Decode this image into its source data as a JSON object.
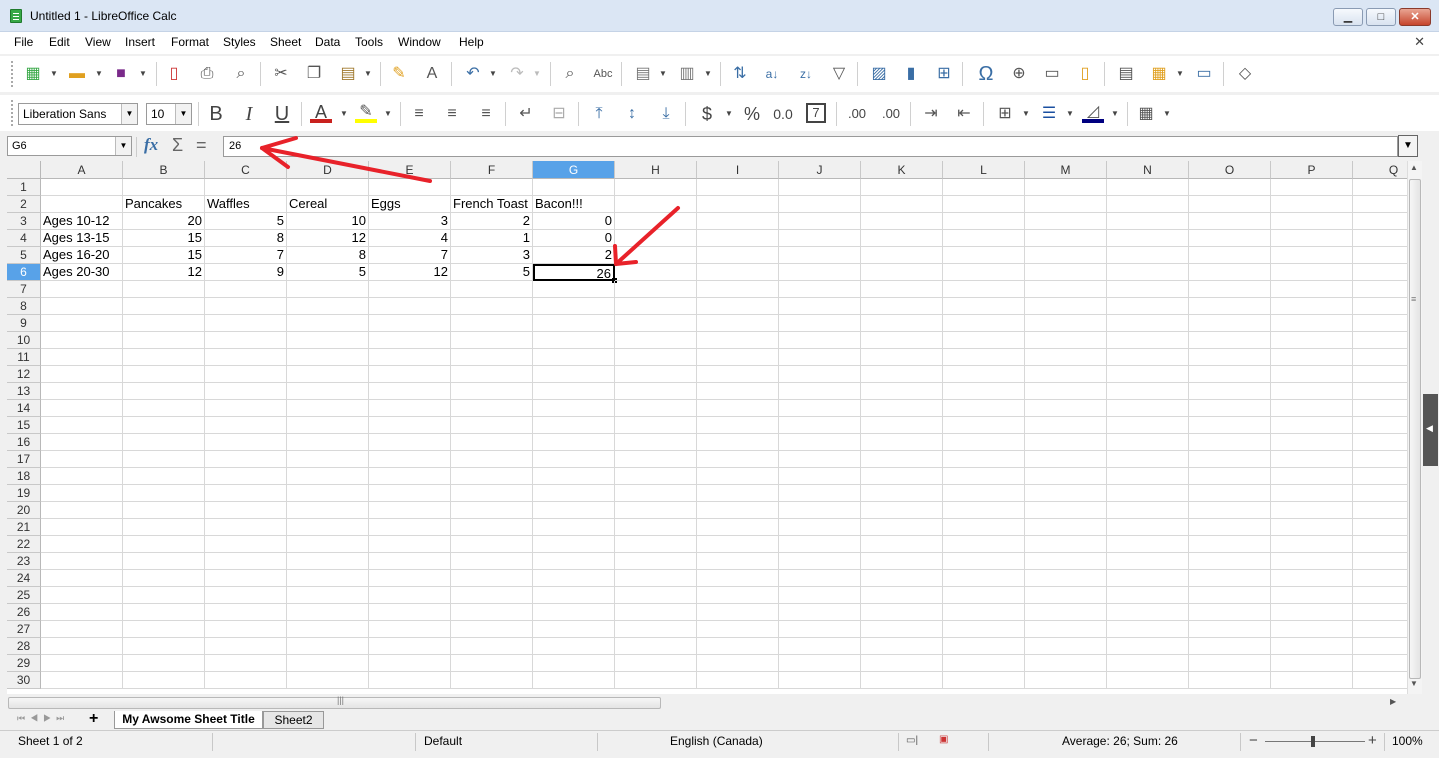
{
  "window": {
    "title": "Untitled 1 - LibreOffice Calc",
    "minimize": "▁",
    "maximize": "□",
    "close": "✕"
  },
  "menu": [
    "File",
    "Edit",
    "View",
    "Insert",
    "Format",
    "Styles",
    "Sheet",
    "Data",
    "Tools",
    "Window",
    "Help"
  ],
  "doc_close": "✕",
  "toolbar_format": {
    "font_name": "Liberation Sans",
    "font_size": "10",
    "bold": "B",
    "italic": "I",
    "underline": "U",
    "font_color": "A",
    "currency": "$",
    "percent": "%",
    "number": "0.0",
    "date": "7",
    "add_decimal": ".00",
    "del_decimal": ".00"
  },
  "formula_bar": {
    "name_box": "G6",
    "fx": "fx",
    "sum": "Σ",
    "equals": "=",
    "input": "26"
  },
  "columns": [
    "A",
    "B",
    "C",
    "D",
    "E",
    "F",
    "G",
    "H",
    "I",
    "J",
    "K",
    "L",
    "M",
    "N",
    "O",
    "P",
    "Q"
  ],
  "rows": [
    "1",
    "2",
    "3",
    "4",
    "5",
    "6",
    "7",
    "8",
    "9",
    "10",
    "11",
    "12",
    "13",
    "14",
    "15",
    "16",
    "17",
    "18",
    "19",
    "20",
    "21",
    "22",
    "23",
    "24",
    "25",
    "26",
    "27",
    "28",
    "29",
    "30"
  ],
  "selected": {
    "column": "G",
    "row": "6"
  },
  "cells": {
    "r2": [
      "",
      "Pancakes",
      "Waffles",
      "Cereal",
      "Eggs",
      "French Toast",
      "Bacon!!!"
    ],
    "r3": [
      "Ages 10-12",
      "20",
      "5",
      "10",
      "3",
      "2",
      "0"
    ],
    "r4": [
      "Ages 13-15",
      "15",
      "8",
      "12",
      "4",
      "1",
      "0"
    ],
    "r5": [
      "Ages 16-20",
      "15",
      "7",
      "8",
      "7",
      "3",
      "2"
    ],
    "r6": [
      "Ages 20-30",
      "12",
      "9",
      "5",
      "12",
      "5",
      "26"
    ]
  },
  "sheet_tabs": [
    "My Awsome Sheet Title",
    "Sheet2"
  ],
  "status": {
    "sheet": "Sheet 1 of 2",
    "page_style": "Default",
    "language": "English (Canada)",
    "summary": "Average: 26; Sum: 26",
    "zoom": "100%"
  },
  "colors": {
    "selection": "#58a2e8",
    "annotation": "#e8222a",
    "font_color_bar": "#c9211e",
    "highlight_bar": "#ffff00"
  }
}
